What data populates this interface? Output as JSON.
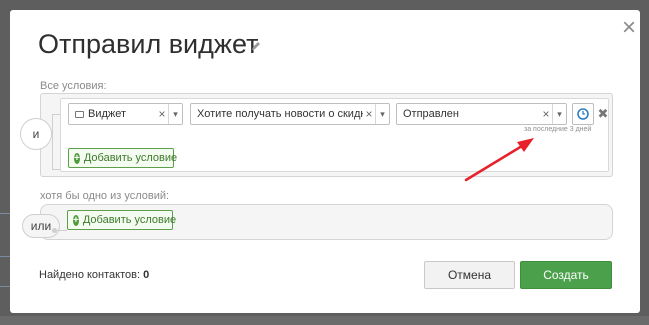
{
  "modal": {
    "title": "Отправил виджет",
    "close_icon": "close-icon",
    "edit_icon": "pencil-icon",
    "all_conditions_label": "Все условия:",
    "any_conditions_label": "хотя бы одно из условий:",
    "and_label": "и",
    "or_label": "или",
    "rule": {
      "type_value": "Виджет",
      "question_value": "Хотите получать новости о скидках?",
      "status_value": "Отправлен",
      "period_hint": "за последние 3 дней"
    },
    "add_condition_label": "Добавить условие",
    "found_label": "Найдено контактов:",
    "found_count": "0",
    "cancel_label": "Отмена",
    "create_label": "Создать"
  },
  "colors": {
    "primary_green": "#4ba04b",
    "annotation_arrow": "#e8202a",
    "clock_blue": "#2f7fc2"
  }
}
